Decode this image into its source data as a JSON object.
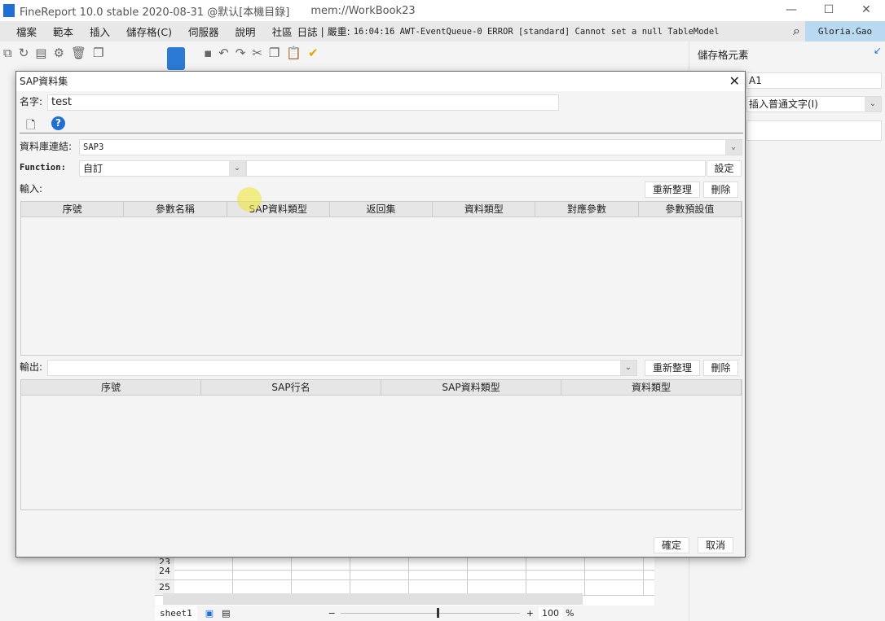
{
  "window": {
    "title": "FineReport 10.0 stable 2020-08-31 @默认[本機目錄]",
    "path": "mem://WorkBook23",
    "minimize": "—",
    "maximize": "☐",
    "close": "✕"
  },
  "menu": {
    "items": [
      "檔案",
      "範本",
      "插入",
      "儲存格(C)",
      "伺服器",
      "說明",
      "社區",
      "日誌"
    ],
    "severity": "嚴重:",
    "log": "16:04:16 AWT-EventQueue-0 ERROR [standard] Cannot set a null TableModel",
    "user": "Gloria.Gao"
  },
  "right_panel": {
    "title": "儲存格元素",
    "cell": "A1",
    "insert_type": "插入普通文字(I)"
  },
  "sheet": {
    "rows": [
      "23",
      "24",
      "25"
    ],
    "tab": "sheet1",
    "zoom": "100",
    "percent": "%"
  },
  "dialog": {
    "title": "SAP資料集",
    "name_label": "名字:",
    "name_value": "test",
    "db_label": "資料庫連結:",
    "db_value": "SAP3",
    "function_label": "Function:",
    "function_value": "自訂",
    "set_button": "設定",
    "input_label": "輸入:",
    "refresh_button": "重新整理",
    "delete_button": "刪除",
    "input_columns": [
      "序號",
      "參數名稱",
      "SAP資料類型",
      "返回集",
      "資料類型",
      "對應參數",
      "參數預設值"
    ],
    "output_label": "輸出:",
    "output_value": "",
    "output_columns": [
      "序號",
      "SAP行名",
      "SAP資料類型",
      "資料類型"
    ],
    "ok_button": "確定",
    "cancel_button": "取消"
  }
}
